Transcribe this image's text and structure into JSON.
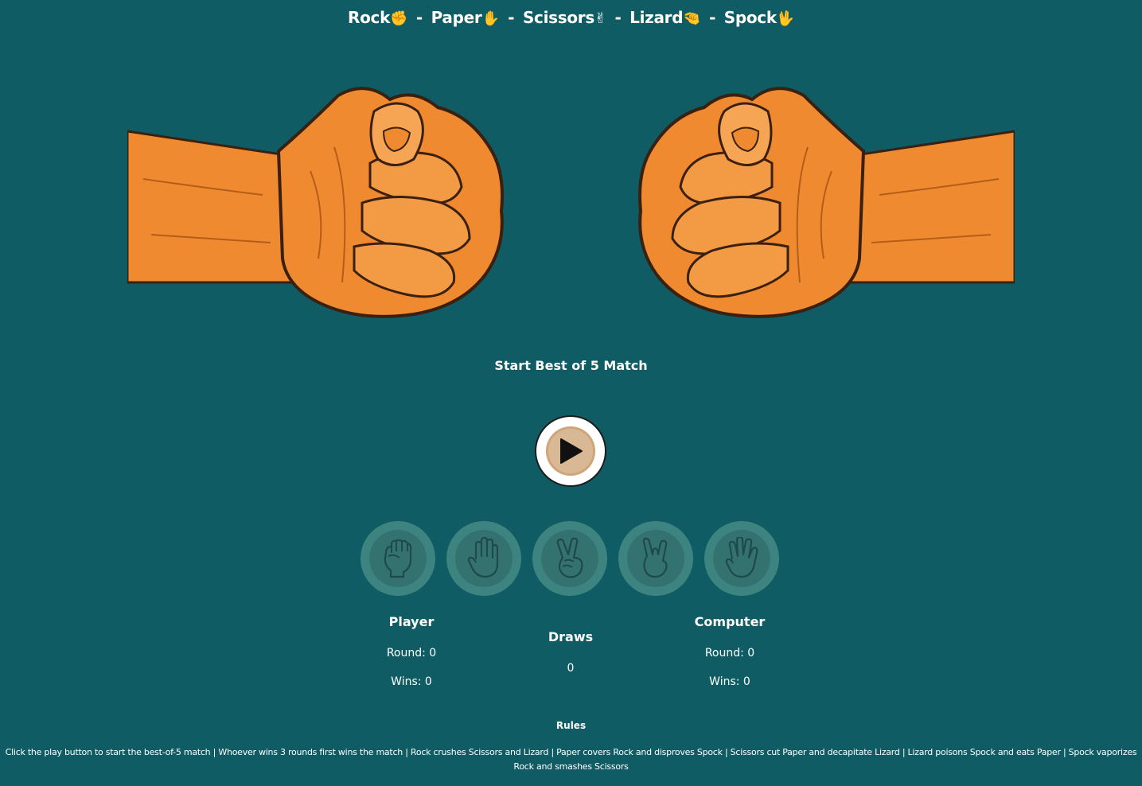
{
  "title": {
    "rock": "Rock",
    "rock_emoji": "✊",
    "paper": "Paper",
    "paper_emoji": "✋",
    "scissors": "Scissors",
    "scissors_emoji": "✌",
    "lizard": "Lizard",
    "lizard_emoji": "🤏",
    "spock": "Spock",
    "spock_emoji": "🖖",
    "separator": "-"
  },
  "colors": {
    "background": "#0f5c64",
    "hand_fill": "#f08a30",
    "choice_button": "#3d8480",
    "play_button_inner": "#d9b895"
  },
  "hands": {
    "player": "fist-illustration",
    "computer": "fist-illustration"
  },
  "start_label": "Start Best of 5 Match",
  "play_button": {
    "icon": "play-icon"
  },
  "choices": [
    {
      "id": "rock",
      "icon": "rock-fist-icon"
    },
    {
      "id": "paper",
      "icon": "paper-hand-icon"
    },
    {
      "id": "scissors",
      "icon": "scissors-hand-icon"
    },
    {
      "id": "lizard",
      "icon": "lizard-hand-icon"
    },
    {
      "id": "spock",
      "icon": "spock-hand-icon"
    }
  ],
  "player": {
    "label": "Player",
    "round": "Round: 0",
    "wins": "Wins: 0"
  },
  "draws": {
    "label": "Draws",
    "value": "0"
  },
  "computer": {
    "label": "Computer",
    "round": "Round: 0",
    "wins": "Wins: 0"
  },
  "rules": {
    "title": "Rules",
    "text": "Click the play button to start the best-of-5 match | Whoever wins 3 rounds first wins the match | Rock crushes Scissors and Lizard | Paper covers Rock and disproves Spock | Scissors cut Paper and decapitate Lizard | Lizard poisons Spock and eats Paper | Spock vaporizes Rock and smashes Scissors"
  }
}
